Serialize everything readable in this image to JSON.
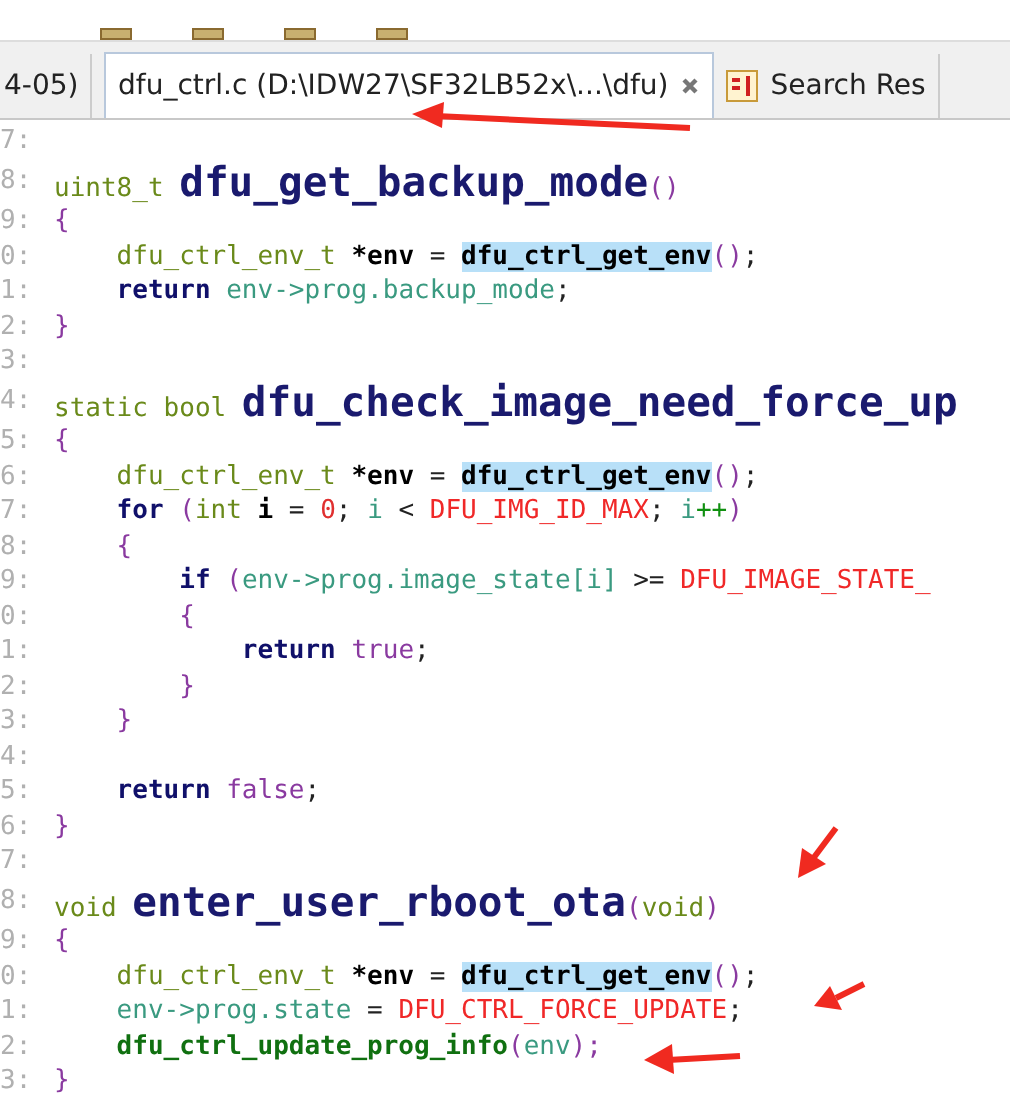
{
  "tabs": [
    {
      "label": "4-05)",
      "selected": false,
      "kind": "file"
    },
    {
      "label": "dfu_ctrl.c (D:\\IDW27\\SF32LB52x\\...\\dfu)",
      "selected": true,
      "kind": "file"
    },
    {
      "label": "Search Res",
      "selected": false,
      "kind": "search"
    }
  ],
  "code": {
    "lines": [
      {
        "number": "7:"
      },
      {
        "number": "8:",
        "tokens": [
          {
            "kind": "type",
            "text": "uint8_t "
          },
          {
            "kind": "fn",
            "text": "dfu_get_backup_mode"
          },
          {
            "kind": "paren",
            "text": "()"
          }
        ]
      },
      {
        "number": "9:",
        "tokens": [
          {
            "kind": "paren",
            "text": "{"
          }
        ]
      },
      {
        "number": "0:",
        "tokens": [
          {
            "kind": "type",
            "text": "    dfu_ctrl_env_t "
          },
          {
            "kind": "var",
            "text": "*env"
          },
          {
            "kind": "op",
            "text": " = "
          },
          {
            "kind": "hl",
            "text": "dfu_ctrl_get_env"
          },
          {
            "kind": "paren",
            "text": "()"
          },
          {
            "kind": "op",
            "text": ";"
          }
        ]
      },
      {
        "number": "1:",
        "tokens": [
          {
            "kind": "kw",
            "text": "    return"
          },
          {
            "kind": "ident",
            "text": " env->prog.backup_mode"
          },
          {
            "kind": "op",
            "text": ";"
          }
        ]
      },
      {
        "number": "2:",
        "tokens": [
          {
            "kind": "paren",
            "text": "}"
          }
        ]
      },
      {
        "number": "3:"
      },
      {
        "number": "4:",
        "tokens": [
          {
            "kind": "type",
            "text": "static bool "
          },
          {
            "kind": "fn",
            "text": "dfu_check_image_need_force_up"
          }
        ]
      },
      {
        "number": "5:",
        "tokens": [
          {
            "kind": "paren",
            "text": "{"
          }
        ]
      },
      {
        "number": "6:",
        "tokens": [
          {
            "kind": "type",
            "text": "    dfu_ctrl_env_t "
          },
          {
            "kind": "var",
            "text": "*env"
          },
          {
            "kind": "op",
            "text": " = "
          },
          {
            "kind": "hl",
            "text": "dfu_ctrl_get_env"
          },
          {
            "kind": "paren",
            "text": "()"
          },
          {
            "kind": "op",
            "text": ";"
          }
        ]
      },
      {
        "number": "7:",
        "tokens": [
          {
            "kind": "kw",
            "text": "    for"
          },
          {
            "kind": "paren",
            "text": " ("
          },
          {
            "kind": "type",
            "text": "int "
          },
          {
            "kind": "var",
            "text": "i"
          },
          {
            "kind": "op",
            "text": " = "
          },
          {
            "kind": "num",
            "text": "0"
          },
          {
            "kind": "op",
            "text": "; "
          },
          {
            "kind": "ident",
            "text": "i"
          },
          {
            "kind": "op",
            "text": " < "
          },
          {
            "kind": "macro",
            "text": "DFU_IMG_ID_MAX"
          },
          {
            "kind": "op",
            "text": "; "
          },
          {
            "kind": "ident",
            "text": "i"
          },
          {
            "kind": "incr",
            "text": "++"
          },
          {
            "kind": "paren",
            "text": ")"
          }
        ]
      },
      {
        "number": "8:",
        "tokens": [
          {
            "kind": "paren",
            "text": "    {"
          }
        ]
      },
      {
        "number": "9:",
        "tokens": [
          {
            "kind": "kw",
            "text": "        if"
          },
          {
            "kind": "paren",
            "text": " ("
          },
          {
            "kind": "ident",
            "text": "env->prog.image_state[i]"
          },
          {
            "kind": "op",
            "text": " >= "
          },
          {
            "kind": "macro",
            "text": "DFU_IMAGE_STATE_"
          }
        ]
      },
      {
        "number": "0:",
        "tokens": [
          {
            "kind": "paren",
            "text": "        {"
          }
        ]
      },
      {
        "number": "1:",
        "tokens": [
          {
            "kind": "kw",
            "text": "            return"
          },
          {
            "kind": "const",
            "text": " true"
          },
          {
            "kind": "op",
            "text": ";"
          }
        ]
      },
      {
        "number": "2:",
        "tokens": [
          {
            "kind": "paren",
            "text": "        }"
          }
        ]
      },
      {
        "number": "3:",
        "tokens": [
          {
            "kind": "paren",
            "text": "    }"
          }
        ]
      },
      {
        "number": "4:"
      },
      {
        "number": "5:",
        "tokens": [
          {
            "kind": "kw",
            "text": "    return"
          },
          {
            "kind": "const",
            "text": " false"
          },
          {
            "kind": "op",
            "text": ";"
          }
        ]
      },
      {
        "number": "6:",
        "tokens": [
          {
            "kind": "paren",
            "text": "}"
          }
        ]
      },
      {
        "number": "7:"
      },
      {
        "number": "8:",
        "tokens": [
          {
            "kind": "type",
            "text": "void "
          },
          {
            "kind": "fn",
            "text": "enter_user_rboot_ota"
          },
          {
            "kind": "paren",
            "text": "("
          },
          {
            "kind": "type",
            "text": "void"
          },
          {
            "kind": "paren",
            "text": ")"
          }
        ]
      },
      {
        "number": "9:",
        "tokens": [
          {
            "kind": "paren",
            "text": "{"
          }
        ]
      },
      {
        "number": "0:",
        "tokens": [
          {
            "kind": "type",
            "text": "    dfu_ctrl_env_t "
          },
          {
            "kind": "var",
            "text": "*env"
          },
          {
            "kind": "op",
            "text": " = "
          },
          {
            "kind": "hl",
            "text": "dfu_ctrl_get_env"
          },
          {
            "kind": "paren",
            "text": "()"
          },
          {
            "kind": "op",
            "text": ";"
          }
        ]
      },
      {
        "number": "1:",
        "tokens": [
          {
            "kind": "ident",
            "text": "    env->prog.state"
          },
          {
            "kind": "op",
            "text": " = "
          },
          {
            "kind": "macro",
            "text": "DFU_CTRL_FORCE_UPDATE"
          },
          {
            "kind": "op",
            "text": ";"
          }
        ]
      },
      {
        "number": "2:",
        "tokens": [
          {
            "kind": "call",
            "text": "    dfu_ctrl_update_prog_info"
          },
          {
            "kind": "paren",
            "text": "("
          },
          {
            "kind": "ident",
            "text": "env"
          },
          {
            "kind": "paren",
            "text": ");"
          }
        ]
      },
      {
        "number": "3:",
        "tokens": [
          {
            "kind": "paren",
            "text": "}"
          }
        ]
      }
    ]
  }
}
